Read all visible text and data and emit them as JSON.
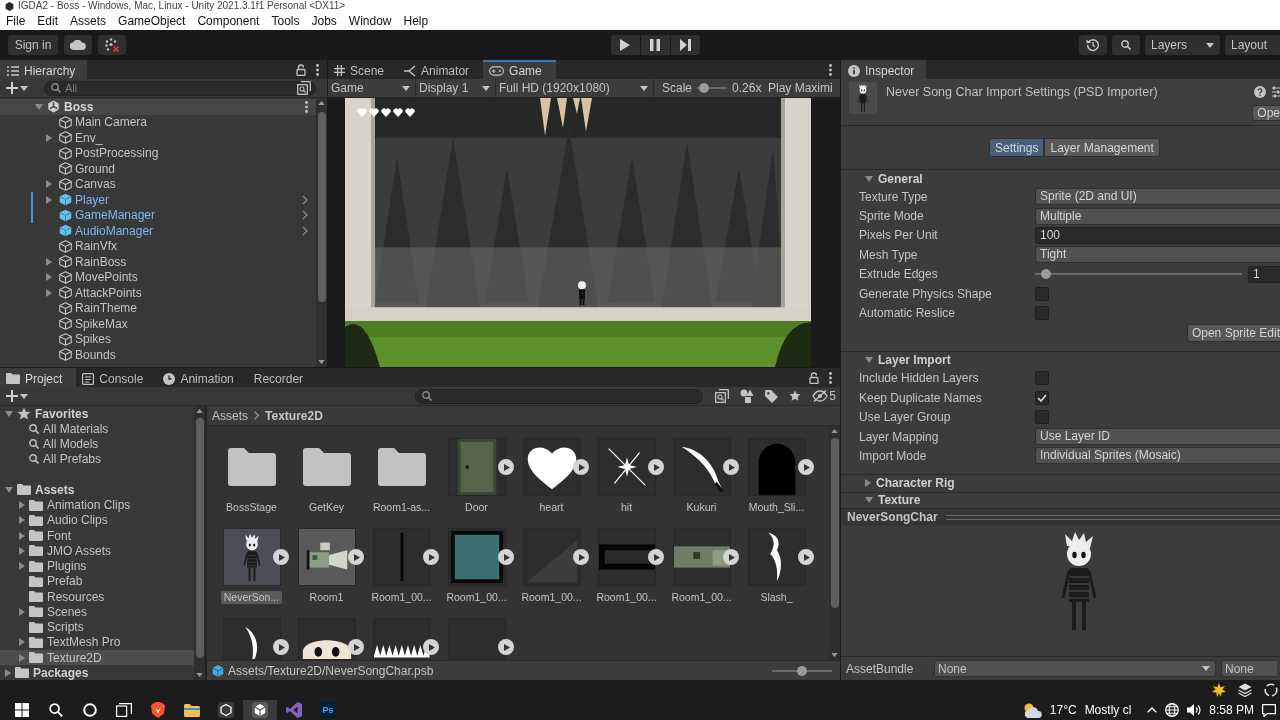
{
  "window": {
    "title": "IGDA2 - Boss - Windows, Mac, Linux - Unity 2021.3.1f1 Personal <DX11>"
  },
  "menu": [
    "File",
    "Edit",
    "Assets",
    "GameObject",
    "Component",
    "Tools",
    "Jobs",
    "Window",
    "Help"
  ],
  "toolbar": {
    "sign_in": "Sign in",
    "layers": "Layers",
    "layout": "Layout"
  },
  "hierarchy": {
    "tab": "Hierarchy",
    "search": {
      "placeholder": "All"
    },
    "scene": {
      "name": "Boss",
      "expanded": true
    },
    "items": [
      {
        "label": "Main Camera",
        "expandable": false,
        "prefab": false,
        "modified": false
      },
      {
        "label": "Env_",
        "expandable": true,
        "prefab": false,
        "modified": false
      },
      {
        "label": "PostProcessing",
        "expandable": false,
        "prefab": false,
        "modified": false
      },
      {
        "label": "Ground",
        "expandable": false,
        "prefab": false,
        "modified": false
      },
      {
        "label": "Canvas",
        "expandable": true,
        "prefab": false,
        "modified": false
      },
      {
        "label": "Player",
        "expandable": true,
        "prefab": true,
        "modified": true
      },
      {
        "label": "GameManager",
        "expandable": false,
        "prefab": true,
        "modified": true
      },
      {
        "label": "AudioManager",
        "expandable": false,
        "prefab": true,
        "modified": false
      },
      {
        "label": "RainVfx",
        "expandable": false,
        "prefab": false,
        "modified": false
      },
      {
        "label": "RainBoss",
        "expandable": true,
        "prefab": false,
        "modified": false
      },
      {
        "label": "MovePoints",
        "expandable": true,
        "prefab": false,
        "modified": false
      },
      {
        "label": "AttackPoints",
        "expandable": true,
        "prefab": false,
        "modified": false
      },
      {
        "label": "RainTheme",
        "expandable": false,
        "prefab": false,
        "modified": false
      },
      {
        "label": "SpikeMax",
        "expandable": false,
        "prefab": false,
        "modified": false
      },
      {
        "label": "Spikes",
        "expandable": false,
        "prefab": false,
        "modified": false
      },
      {
        "label": "Bounds",
        "expandable": false,
        "prefab": false,
        "modified": false
      }
    ]
  },
  "scene_view": {
    "focused": true,
    "tabs": [
      {
        "label": "Scene",
        "kind": "scene",
        "selected": false
      },
      {
        "label": "Animator",
        "kind": "animator",
        "selected": false
      },
      {
        "label": "Game",
        "kind": "game",
        "selected": true
      }
    ],
    "view_mode": "Game",
    "display": "Display 1",
    "resolution": "Full HD (1920x1080)",
    "scale": {
      "label": "Scale",
      "level": 0.1,
      "reading": "0.26x"
    },
    "play_mode": "Play Maximi"
  },
  "inspector": {
    "tab": "Inspector",
    "title": "Never Song Char Import Settings (PSD Importer)",
    "open_button": "Ope",
    "tabs": [
      {
        "label": "Settings",
        "selected": true
      },
      {
        "label": "Layer Management",
        "selected": false
      }
    ],
    "sections": [
      {
        "title": "General",
        "expanded": true,
        "rows": [
          {
            "kind": "dropdown",
            "label": "Texture Type",
            "value": "Sprite (2D and UI)"
          },
          {
            "kind": "dropdown",
            "label": "Sprite Mode",
            "value": "Multiple"
          },
          {
            "kind": "text",
            "label": "Pixels Per Unit",
            "value": "100"
          },
          {
            "kind": "dropdown",
            "label": "Mesh Type",
            "value": "Tight"
          },
          {
            "kind": "slider",
            "label": "Extrude Edges",
            "level": 0.03,
            "value": "1"
          },
          {
            "kind": "checkbox",
            "label": "Generate Physics Shape",
            "checked": false
          },
          {
            "kind": "checkbox",
            "label": "Automatic Reslice",
            "checked": false
          },
          {
            "kind": "button",
            "label": "Open Sprite Edit"
          }
        ]
      },
      {
        "title": "Layer Import",
        "expanded": true,
        "rows": [
          {
            "kind": "checkbox",
            "label": "Include Hidden Layers",
            "checked": false
          },
          {
            "kind": "checkbox",
            "label": "Keep Duplicate Names",
            "checked": true
          },
          {
            "kind": "checkbox",
            "label": "Use Layer Group",
            "checked": false
          },
          {
            "kind": "dropdown",
            "label": "Layer Mapping",
            "value": "Use Layer ID"
          },
          {
            "kind": "dropdown",
            "label": "Import Mode",
            "value": "Individual Sprites (Mosaic)"
          }
        ]
      },
      {
        "title": "Character Rig",
        "expanded": false
      },
      {
        "title": "Texture",
        "expanded": true
      }
    ],
    "preview": {
      "title": "NeverSongChar"
    },
    "asset_bundle": {
      "label": "AssetBundle",
      "name": "None",
      "variant": "None"
    }
  },
  "project": {
    "focused": false,
    "tabs": [
      {
        "label": "Project",
        "kind": "folder",
        "selected": true
      },
      {
        "label": "Console",
        "kind": "console",
        "selected": false
      },
      {
        "label": "Animation",
        "kind": "clock",
        "selected": false
      },
      {
        "label": "Recorder",
        "kind": "plain",
        "selected": false
      }
    ],
    "hidden_count": "5",
    "tree": [
      {
        "label": "Favorites",
        "kind": "star",
        "expanded": true,
        "selected": false,
        "children": [
          {
            "label": "All Materials",
            "kind": "search",
            "expandable": false,
            "selected": false
          },
          {
            "label": "All Models",
            "kind": "search",
            "expandable": false,
            "selected": false
          },
          {
            "label": "All Prefabs",
            "kind": "search",
            "expandable": false,
            "selected": false
          }
        ]
      },
      {
        "label": "Assets",
        "kind": "folder",
        "expanded": true,
        "selected": false,
        "children": [
          {
            "label": "Animation Clips",
            "kind": "folder",
            "expandable": true,
            "selected": false
          },
          {
            "label": "Audio Clips",
            "kind": "folder",
            "expandable": true,
            "selected": false
          },
          {
            "label": "Font",
            "kind": "folder",
            "expandable": true,
            "selected": false
          },
          {
            "label": "JMO Assets",
            "kind": "folder",
            "expandable": true,
            "selected": false
          },
          {
            "label": "Plugins",
            "kind": "folder",
            "expandable": true,
            "selected": false
          },
          {
            "label": "Prefab",
            "kind": "folder",
            "expandable": false,
            "selected": false
          },
          {
            "label": "Resources",
            "kind": "folder",
            "expandable": false,
            "selected": false
          },
          {
            "label": "Scenes",
            "kind": "folder",
            "expandable": true,
            "selected": false
          },
          {
            "label": "Scripts",
            "kind": "folder",
            "expandable": false,
            "selected": false
          },
          {
            "label": "TextMesh Pro",
            "kind": "folder",
            "expandable": true,
            "selected": false
          },
          {
            "label": "Texture2D",
            "kind": "folder",
            "expandable": true,
            "selected": true
          }
        ]
      },
      {
        "label": "Packages",
        "kind": "folder",
        "expanded": false,
        "selected": false
      }
    ],
    "breadcrumb": [
      "Assets",
      "Texture2D"
    ],
    "assets": [
      {
        "label": "BossStage",
        "kind": "folder",
        "selected": false,
        "expandable": false
      },
      {
        "label": "GetKey",
        "kind": "folder",
        "selected": false,
        "expandable": false
      },
      {
        "label": "Room1-as...",
        "kind": "folder",
        "selected": false,
        "expandable": false
      },
      {
        "label": "Door",
        "kind": "door",
        "selected": false,
        "expandable": true
      },
      {
        "label": "heart",
        "kind": "heart",
        "selected": false,
        "expandable": true
      },
      {
        "label": "hit",
        "kind": "sparkle",
        "selected": false,
        "expandable": true
      },
      {
        "label": "Kukuri",
        "kind": "blade",
        "selected": false,
        "expandable": true
      },
      {
        "label": "Mouth_Sli...",
        "kind": "arch",
        "selected": false,
        "expandable": true
      },
      {
        "label": "NeverSon...",
        "kind": "character",
        "selected": true,
        "expandable": true
      },
      {
        "label": "Room1",
        "kind": "room",
        "selected": false,
        "expandable": true
      },
      {
        "label": "Room1_00...",
        "kind": "bar",
        "selected": false,
        "expandable": true
      },
      {
        "label": "Room1_00...",
        "kind": "tile",
        "selected": false,
        "expandable": true
      },
      {
        "label": "Room1_00...",
        "kind": "shade",
        "selected": false,
        "expandable": true
      },
      {
        "label": "Room1_00...",
        "kind": "frame",
        "selected": false,
        "expandable": true
      },
      {
        "label": "Room1_00...",
        "kind": "strip",
        "selected": false,
        "expandable": true
      },
      {
        "label": "Slash_",
        "kind": "hook",
        "selected": false,
        "expandable": true
      },
      {
        "kind": "crescent",
        "selected": false,
        "expandable": true
      },
      {
        "kind": "ghost",
        "selected": false,
        "expandable": true
      },
      {
        "kind": "spikes",
        "selected": false,
        "expandable": true
      },
      {
        "kind": "blank",
        "selected": false,
        "expandable": true
      }
    ],
    "status": {
      "path": "Assets/Texture2D/NeverSongChar.psb",
      "zoom": {
        "level": 0.5
      }
    }
  },
  "taskbar": {
    "tray_top": [
      {
        "kind": "burst"
      },
      {
        "kind": "stack"
      },
      {
        "kind": "ring"
      }
    ],
    "apps": [
      {
        "kind": "start",
        "selected": false
      },
      {
        "kind": "search",
        "selected": false
      },
      {
        "kind": "cortana",
        "selected": false
      },
      {
        "kind": "taskview",
        "selected": false
      },
      {
        "kind": "shield",
        "selected": false
      },
      {
        "kind": "files",
        "selected": false
      },
      {
        "kind": "hub",
        "selected": false
      },
      {
        "kind": "editor",
        "selected": true
      },
      {
        "kind": "ribbon",
        "selected": false
      },
      {
        "kind": "ps",
        "label": "Ps",
        "selected": false
      }
    ],
    "weather": {
      "temp": "17°C",
      "text": "Mostly cl"
    },
    "clock": "8:58 PM"
  }
}
